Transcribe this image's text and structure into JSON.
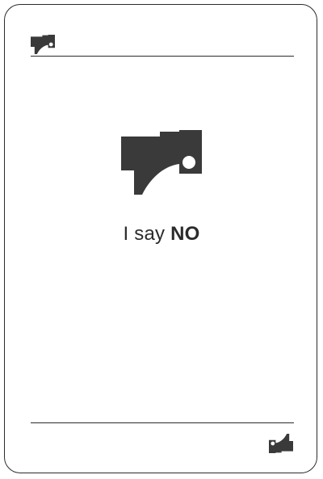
{
  "card": {
    "caption_prefix": "I say ",
    "caption_emphasis": "NO",
    "icon": "hammer-icon",
    "ink_color": "#3a3a3a"
  }
}
